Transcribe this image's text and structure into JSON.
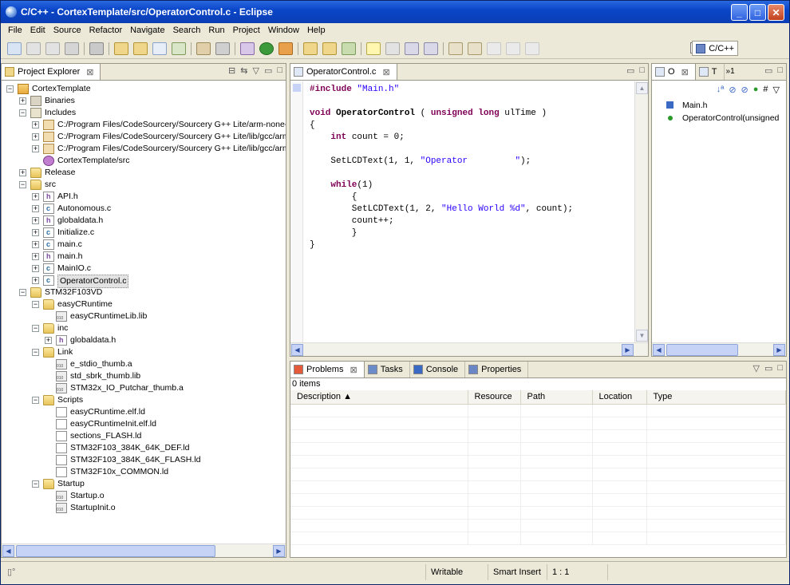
{
  "window": {
    "title": "C/C++ - CortexTemplate/src/OperatorControl.c - Eclipse",
    "minimize": "_",
    "maximize": "□",
    "close": "✕"
  },
  "menu": [
    "File",
    "Edit",
    "Source",
    "Refactor",
    "Navigate",
    "Search",
    "Run",
    "Project",
    "Window",
    "Help"
  ],
  "perspective": {
    "label": "C/C++"
  },
  "project_explorer": {
    "tab_label": "Project Explorer",
    "items": [
      {
        "label": "CortexTemplate",
        "depth": 0,
        "expander": "−",
        "icon": "project-icon"
      },
      {
        "label": "Binaries",
        "depth": 1,
        "expander": "+",
        "icon": "binaries-icon"
      },
      {
        "label": "Includes",
        "depth": 1,
        "expander": "−",
        "icon": "includes-icon"
      },
      {
        "label": "C:/Program Files/CodeSourcery/Sourcery G++ Lite/arm-none-ea",
        "depth": 2,
        "expander": "+",
        "icon": "include-path-icon"
      },
      {
        "label": "C:/Program Files/CodeSourcery/Sourcery G++ Lite/lib/gcc/arm-n",
        "depth": 2,
        "expander": "+",
        "icon": "include-path-icon"
      },
      {
        "label": "C:/Program Files/CodeSourcery/Sourcery G++ Lite/lib/gcc/arm-n",
        "depth": 2,
        "expander": "+",
        "icon": "include-path-icon"
      },
      {
        "label": "CortexTemplate/src",
        "depth": 2,
        "expander": "",
        "icon": "source-folder-icon"
      },
      {
        "label": "Release",
        "depth": 1,
        "expander": "+",
        "icon": "folder-icon"
      },
      {
        "label": "src",
        "depth": 1,
        "expander": "−",
        "icon": "folder-icon"
      },
      {
        "label": "API.h",
        "depth": 2,
        "expander": "+",
        "icon": "header-file-icon"
      },
      {
        "label": "Autonomous.c",
        "depth": 2,
        "expander": "+",
        "icon": "c-file-icon"
      },
      {
        "label": "globaldata.h",
        "depth": 2,
        "expander": "+",
        "icon": "header-file-icon"
      },
      {
        "label": "Initialize.c",
        "depth": 2,
        "expander": "+",
        "icon": "c-file-icon"
      },
      {
        "label": "main.c",
        "depth": 2,
        "expander": "+",
        "icon": "c-file-icon"
      },
      {
        "label": "main.h",
        "depth": 2,
        "expander": "+",
        "icon": "header-file-icon"
      },
      {
        "label": "MainIO.c",
        "depth": 2,
        "expander": "+",
        "icon": "c-file-icon"
      },
      {
        "label": "OperatorControl.c",
        "depth": 2,
        "expander": "+",
        "icon": "c-file-icon",
        "selected": true
      },
      {
        "label": "STM32F103VD",
        "depth": 1,
        "expander": "−",
        "icon": "folder-icon"
      },
      {
        "label": "easyCRuntime",
        "depth": 2,
        "expander": "−",
        "icon": "folder-icon"
      },
      {
        "label": "easyCRuntimeLib.lib",
        "depth": 3,
        "expander": "",
        "icon": "library-file-icon"
      },
      {
        "label": "inc",
        "depth": 2,
        "expander": "−",
        "icon": "folder-icon"
      },
      {
        "label": "globaldata.h",
        "depth": 3,
        "expander": "+",
        "icon": "header-file-icon"
      },
      {
        "label": "Link",
        "depth": 2,
        "expander": "−",
        "icon": "folder-icon"
      },
      {
        "label": "e_stdio_thumb.a",
        "depth": 3,
        "expander": "",
        "icon": "library-file-icon"
      },
      {
        "label": "std_sbrk_thumb.lib",
        "depth": 3,
        "expander": "",
        "icon": "library-file-icon"
      },
      {
        "label": "STM32x_IO_Putchar_thumb.a",
        "depth": 3,
        "expander": "",
        "icon": "library-file-icon"
      },
      {
        "label": "Scripts",
        "depth": 2,
        "expander": "−",
        "icon": "folder-icon"
      },
      {
        "label": "easyCRuntime.elf.ld",
        "depth": 3,
        "expander": "",
        "icon": "text-file-icon"
      },
      {
        "label": "easyCRuntimeInit.elf.ld",
        "depth": 3,
        "expander": "",
        "icon": "text-file-icon"
      },
      {
        "label": "sections_FLASH.ld",
        "depth": 3,
        "expander": "",
        "icon": "text-file-icon"
      },
      {
        "label": "STM32F103_384K_64K_DEF.ld",
        "depth": 3,
        "expander": "",
        "icon": "text-file-icon"
      },
      {
        "label": "STM32F103_384K_64K_FLASH.ld",
        "depth": 3,
        "expander": "",
        "icon": "text-file-icon"
      },
      {
        "label": "STM32F10x_COMMON.ld",
        "depth": 3,
        "expander": "",
        "icon": "text-file-icon"
      },
      {
        "label": "Startup",
        "depth": 2,
        "expander": "−",
        "icon": "folder-icon"
      },
      {
        "label": "Startup.o",
        "depth": 3,
        "expander": "",
        "icon": "library-file-icon"
      },
      {
        "label": "StartupInit.o",
        "depth": 3,
        "expander": "",
        "icon": "library-file-icon"
      }
    ]
  },
  "editor": {
    "tab_label": "OperatorControl.c",
    "lines": [
      [
        {
          "t": "#include ",
          "c": "kw"
        },
        {
          "t": "\"Main.h\"",
          "c": "str"
        }
      ],
      [],
      [
        {
          "t": "void ",
          "c": "kw"
        },
        {
          "t": "OperatorControl",
          "c": "fn"
        },
        {
          "t": " ( "
        },
        {
          "t": "unsigned long ",
          "c": "kw"
        },
        {
          "t": "ulTime )"
        }
      ],
      [
        {
          "t": "{"
        }
      ],
      [
        {
          "t": "    "
        },
        {
          "t": "int",
          "c": "kw"
        },
        {
          "t": " count = 0;"
        }
      ],
      [],
      [
        {
          "t": "    SetLCDText(1, 1, "
        },
        {
          "t": "\"Operator         \"",
          "c": "str"
        },
        {
          "t": ");"
        }
      ],
      [],
      [
        {
          "t": "    "
        },
        {
          "t": "while",
          "c": "kw"
        },
        {
          "t": "(1)"
        }
      ],
      [
        {
          "t": "        {"
        }
      ],
      [
        {
          "t": "        SetLCDText(1, 2, "
        },
        {
          "t": "\"Hello World %d\"",
          "c": "str"
        },
        {
          "t": ", count);"
        }
      ],
      [
        {
          "t": "        count++;"
        }
      ],
      [
        {
          "t": "        }"
        }
      ],
      [
        {
          "t": "}"
        }
      ]
    ]
  },
  "outline": {
    "tab_outline": "O",
    "tab_other": "T",
    "overflow": "»1",
    "items": [
      {
        "label": "Main.h",
        "icon": "include-icon"
      },
      {
        "label": "OperatorControl(unsigned",
        "icon": "function-icon"
      }
    ]
  },
  "bottom_panel": {
    "tabs": [
      "Problems",
      "Tasks",
      "Console",
      "Properties"
    ],
    "count": "0 items",
    "columns": [
      "Description",
      "Resource",
      "Path",
      "Location",
      "Type"
    ]
  },
  "statusbar": {
    "writable": "Writable",
    "insert_mode": "Smart Insert",
    "position": "1 : 1"
  }
}
